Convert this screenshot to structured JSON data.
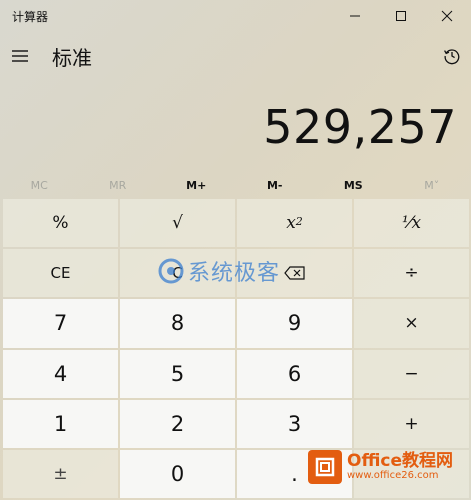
{
  "window": {
    "title": "计算器"
  },
  "header": {
    "mode": "标准"
  },
  "display": {
    "value": "529,257"
  },
  "memory": [
    {
      "label": "MC",
      "enabled": false
    },
    {
      "label": "MR",
      "enabled": false
    },
    {
      "label": "M+",
      "enabled": true
    },
    {
      "label": "M-",
      "enabled": true
    },
    {
      "label": "MS",
      "enabled": true
    },
    {
      "label": "M˅",
      "enabled": false
    }
  ],
  "keys": {
    "percent": "%",
    "sqrt": "√",
    "square_base": "x",
    "square_exp": "2",
    "reciprocal": "⅟x",
    "ce": "CE",
    "c": "C",
    "divide": "÷",
    "seven": "7",
    "eight": "8",
    "nine": "9",
    "multiply": "×",
    "four": "4",
    "five": "5",
    "six": "6",
    "minus": "−",
    "one": "1",
    "two": "2",
    "three": "3",
    "plus": "+",
    "negate": "±",
    "zero": "0",
    "decimal": "."
  },
  "watermarks": {
    "center": "系统极客",
    "corner_main": "Office教程网",
    "corner_sub": "www.office26.com"
  },
  "colors": {
    "accent_blue": "#3b7fd0",
    "watermark_orange": "#e35d10"
  }
}
